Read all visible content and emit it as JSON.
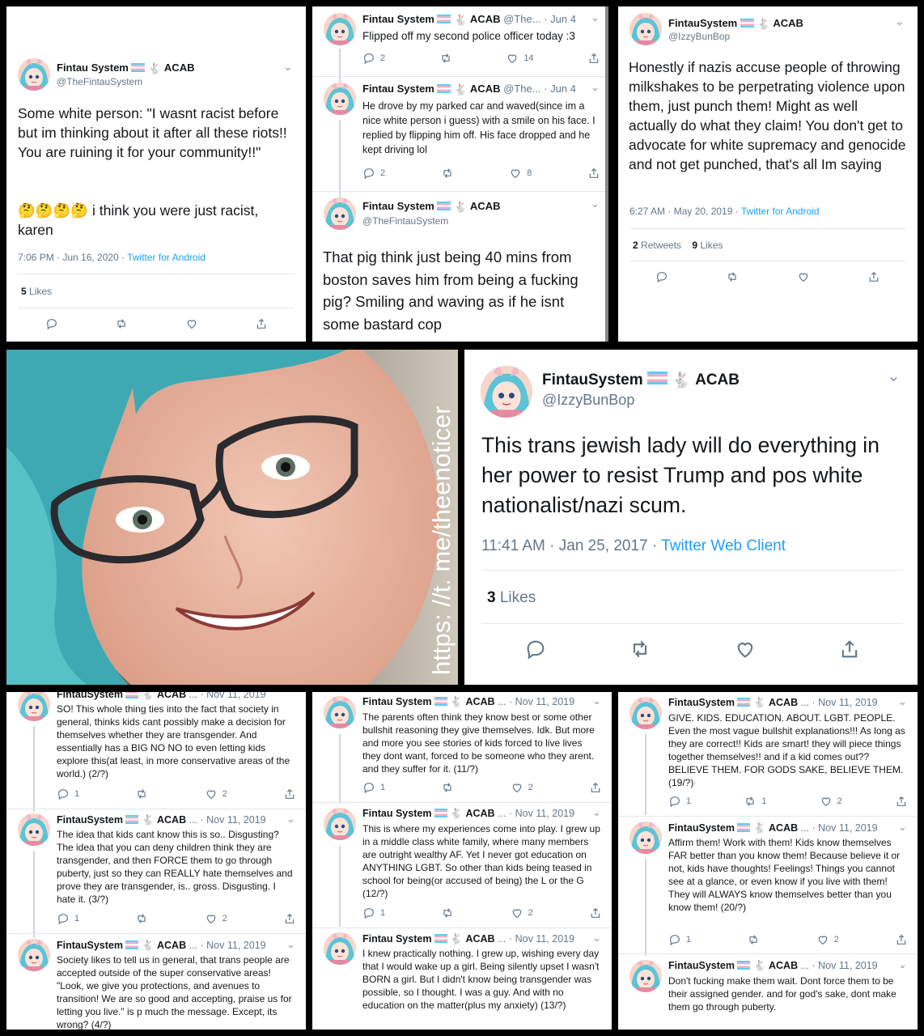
{
  "common": {
    "name_long": "Fintau System",
    "name_short": "FintauSystem",
    "acab": "ACAB",
    "ellipsis": "...",
    "handle_fintau": "@TheFintauSystem",
    "handle_fintau_trunc": "@The...",
    "handle_izzy": "@IzzyBunBop",
    "likes_label": "Likes",
    "retweets_label": "Retweets",
    "dot": "·"
  },
  "p1": {
    "body": "Some white person: \"I wasnt racist before but im thinking about it after all these riots!! You are ruining it for your community!!\"",
    "emoji_line": "i think you were just racist, karen",
    "time": "7:06 PM · Jun 16, 2020",
    "source": "Twitter for Android",
    "likes": "5"
  },
  "p2": {
    "t1": {
      "date": "Jun 4",
      "body": "Flipped off my second police officer today :3",
      "replies": "2",
      "likes": "14"
    },
    "t2": {
      "date": "Jun 4",
      "body": "He drove by my parked car and waved(since im a nice white person i guess) with a smile on his face. I replied by flipping him off. His face dropped and he kept driving lol",
      "replies": "2",
      "likes": "8"
    },
    "t3": {
      "body": "That pig think just being 40 mins from boston saves him from being a fucking pig? Smiling and waving as if he isnt some bastard cop"
    }
  },
  "p3": {
    "body": "Honestly if nazis accuse people of throwing milkshakes to be perpetrating violence upon them, just punch them! Might as well actually do what they claim! You don't get to advocate for white supremacy and genocide and not get punched, that's all Im saying",
    "time": "6:27 AM · May 20, 2019",
    "source": "Twitter for Android",
    "retweets": "2",
    "likes": "9"
  },
  "photo": {
    "watermark": "https: //t. me/theenoticer"
  },
  "p4": {
    "body": "This trans jewish lady will do everything in her power to resist Trump and pos white nationalist/nazi scum.",
    "time": "11:41 AM · Jan 25, 2017",
    "source": "Twitter Web Client",
    "likes": "3"
  },
  "p5": {
    "date": "Nov 11, 2019",
    "t1": {
      "body": "SO!  This whole thing ties into the fact that society in general, thinks kids cant possibly make a decision for themselves whether they are transgender.  And essentially has a BIG NO NO to even letting kids explore this(at least, in more conservative areas of the world.) (2/?)",
      "replies": "1",
      "likes": "2"
    },
    "t2": {
      "body": "The idea that kids cant know this is so.. Disgusting?  The idea that you can deny children think they are transgender, and then FORCE them to go through puberty, just so they can REALLY hate themselves and prove they are transgender, is.. gross.  Disgusting.  I hate it.  (3/?)",
      "replies": "1",
      "likes": "2"
    },
    "t3": {
      "body": "Society likes to tell us in general, that trans people are accepted outside of the super conservative areas!  \"Look, we give you protections, and avenues to transition!  We are so good and accepting, praise us for letting you live.\" is p much the message. Except, its wrong? (4/?)"
    }
  },
  "p6": {
    "date": "Nov 11, 2019",
    "t1": {
      "body": "The parents often think they know best or some other bullshit reasoning they give themselves.  Idk. But more and more you see stories of kids forced to live lives they dont want, forced to be someone who they arent.  and they suffer for it. (11/?)",
      "replies": "1",
      "likes": "2"
    },
    "t2": {
      "body": "This is where my experiences come into play.  I grew up in a middle class white family, where many members are outright wealthy AF.  Yet I never got education on ANYTHING LGBT.  So other than kids being teased in school for being(or accused of being) the L or the G (12/?)",
      "replies": "1",
      "likes": "2"
    },
    "t3": {
      "body": "I knew practically nothing.  I grew up, wishing every day that I would wake up a girl.  Being silently upset I wasn't BORN a girl.  But I didn't know being transgender was possible, so I thought. I was a guy. And with no education on the matter(plus my anxiety) (13/?)"
    }
  },
  "p7": {
    "date": "Nov 11, 2019",
    "t1": {
      "body": "GIVE. KIDS. EDUCATION. ABOUT. LGBT. PEOPLE. Even the most vague bullshit explanations!!!  As long as they are correct!!  Kids are smart! they will piece things together themselves!!  and if a kid comes out??  BELIEVE THEM.  FOR GODS SAKE, BELIEVE THEM.  (19/?)",
      "replies": "1",
      "retweets": "1",
      "likes": "2"
    },
    "t2": {
      "body": "Affirm them!  Work with them!  Kids know themselves FAR better than you know them! Because believe it or not, kids have thoughts! Feelings!  Things you cannot see at a glance, or even know if you live with them!  They will ALWAYS know themselves better than you know them! (20/?)",
      "replies": "1",
      "likes": "2"
    },
    "t3": {
      "body": "Don't fucking make them wait.  Dont force them to be their assigned gender.  and for god's sake, dont make them go through puberty."
    }
  },
  "colors": {
    "twitter_blue": "#1da1f2",
    "text": "#14171a",
    "muted": "#657786",
    "trans_blue": "#5bcefa",
    "trans_pink": "#f5a9b8"
  }
}
